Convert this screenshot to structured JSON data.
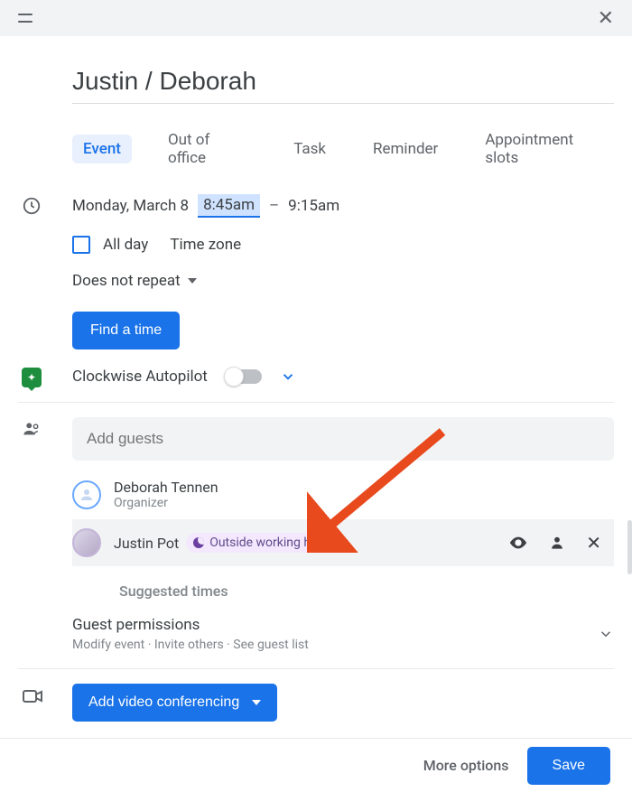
{
  "title": "Justin / Deborah",
  "tabs": [
    "Event",
    "Out of office",
    "Task",
    "Reminder",
    "Appointment slots"
  ],
  "time": {
    "date": "Monday, March 8",
    "start": "8:45am",
    "end": "9:15am",
    "all_day_label": "All day",
    "timezone_label": "Time zone",
    "repeat_label": "Does not repeat",
    "find_time_label": "Find a time"
  },
  "clockwise": {
    "label": "Clockwise Autopilot"
  },
  "guests": {
    "placeholder": "Add guests",
    "items": [
      {
        "name": "Deborah Tennen",
        "role": "Organizer"
      },
      {
        "name": "Justin Pot",
        "badge": "Outside working hours"
      }
    ],
    "suggested_label": "Suggested times",
    "permissions_title": "Guest permissions",
    "permissions_sub": "Modify event · Invite others · See guest list"
  },
  "video": {
    "label": "Add video conferencing"
  },
  "footer": {
    "more_options": "More options",
    "save": "Save"
  }
}
